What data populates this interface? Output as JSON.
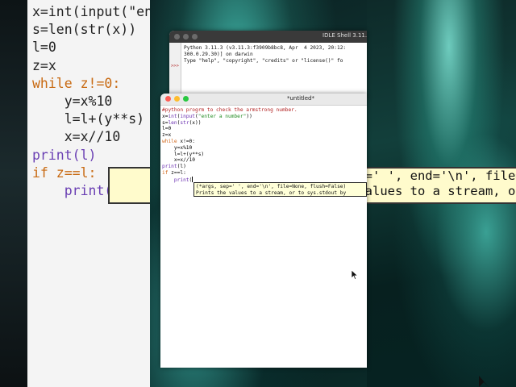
{
  "background": {
    "left_zoom_code": [
      "x=int(input(\"en",
      "s=len(str(x))",
      "l=0",
      "z=x",
      "while z!=0:",
      "    y=x%10",
      "    l=l+(y**s)",
      "    x=x//10",
      "print(l)",
      "if z==l:",
      "    print("
    ],
    "right_zoom_tip": [
      "(*args, sep=' ', end='\\n', file=None, flush=False)",
      "Print the values to a stream, or to sys.stdout by"
    ],
    "accent_colors": {
      "teal": "#3ec5b4",
      "dark": "#0a2a28"
    }
  },
  "shell_window": {
    "title": "IDLE Shell 3.11.3",
    "prompt": ">>>",
    "lines": [
      "Python 3.11.3 (v3.11.3:f3909b8bc8, Apr  4 2023, 20:12:",
      "300.0.29.30)] on darwin",
      "Type \"help\", \"copyright\", \"credits\" or \"license()\" fo"
    ]
  },
  "editor_window": {
    "title": "*untitled*",
    "dot_colors": {
      "close": "#fe5f57",
      "minimize": "#febc2e",
      "zoom": "#28c840"
    },
    "code": {
      "comment": "#python progrm to check the armstrong number.",
      "line2_a": "x=",
      "line2_int": "int",
      "line2_b": "(",
      "line2_input": "input",
      "line2_c": "(",
      "line2_str": "\"enter a number\"",
      "line2_d": "))",
      "line3_a": "s=",
      "line3_len": "len",
      "line3_b": "(",
      "line3_str": "str",
      "line3_c": "(x))",
      "line4": "l=0",
      "line5": "z=x",
      "line6_kw": "while",
      "line6_rest": " x!=0:",
      "line7": "    y=x%10",
      "line8": "    l=l+(y**s)",
      "line9": "    x=x//10",
      "line10_print": "print",
      "line10_rest": "(l)",
      "line11_kw": "if",
      "line11_rest": " z==l:",
      "line12_indent": "    ",
      "line12_print": "print",
      "line12_paren": "("
    },
    "calltip": [
      "(*args, sep=' ', end='\\n', file=None, flush=False)",
      "Prints the values to a stream, or to sys.stdout by"
    ]
  }
}
